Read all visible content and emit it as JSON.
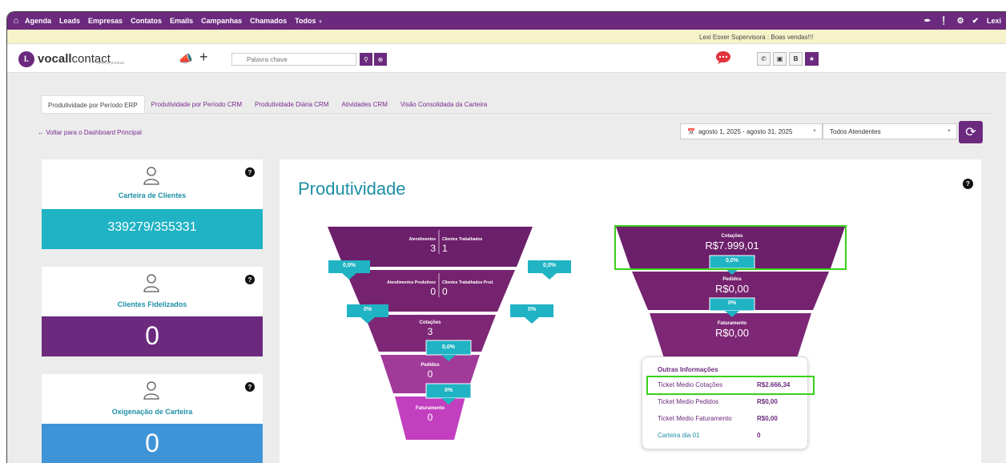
{
  "nav": {
    "items": [
      "Agenda",
      "Leads",
      "Empresas",
      "Contatos",
      "Emails",
      "Campanhas",
      "Chamados",
      "Todos"
    ],
    "user": "Lexi"
  },
  "infobar": {
    "message": "Lexi Eoxer Supervisora : Boas vendas!!!"
  },
  "toolbar": {
    "logo_bold": "vocall",
    "logo_light": "contact",
    "logo_sub": "único e pontual",
    "search_placeholder": "Palavra chave",
    "contact_btn_b": "B"
  },
  "tabs": [
    {
      "label": "Produtividade por Período ERP",
      "active": true
    },
    {
      "label": "Produtividade por Período CRM"
    },
    {
      "label": "Produtividade Diária CRM"
    },
    {
      "label": "Atividades CRM"
    },
    {
      "label": "Visão Consolidada da Carteira"
    }
  ],
  "back_link": "Voltar para o Dashboard Principal",
  "filters": {
    "date_range": "agosto 1, 2025 - agosto 31, 2025",
    "attendant": "Todos Atendentes"
  },
  "cards": [
    {
      "label": "Carteira de Clientes",
      "value": "339279/355331",
      "color": "#1fb3c4"
    },
    {
      "label": "Clientes Fidelizados",
      "value": "0",
      "color": "#6b2a7e"
    },
    {
      "label": "Oxigenação de Carteira",
      "value": "0",
      "color": "#3f94d8"
    }
  ],
  "panel": {
    "title": "Produtividade"
  },
  "funnel_left": {
    "levels": [
      {
        "left_label": "Atendimentos",
        "left_value": "3",
        "right_label": "Clientes Trabalhados",
        "right_value": "1"
      },
      {
        "left_label": "Atendimentos Produtivos",
        "left_value": "0",
        "right_label": "Clientes Trabalhados Prod.",
        "right_value": "0"
      },
      {
        "label": "Cotações",
        "value": "3"
      },
      {
        "label": "Pedidos",
        "value": "0"
      },
      {
        "label": "Faturamento",
        "value": "0"
      }
    ],
    "rates": [
      "0,0%",
      "0,0%",
      "0%",
      "0%",
      "0,0%",
      "0%"
    ]
  },
  "funnel_right": {
    "levels": [
      {
        "label": "Cotações",
        "value": "R$7.999,01"
      },
      {
        "label": "Pedidos",
        "value": "R$0,00"
      },
      {
        "label": "Faturamento",
        "value": "R$0,00"
      }
    ],
    "rates": [
      "0,0%",
      "0%"
    ]
  },
  "other_info": {
    "title": "Outras Informações",
    "rows": [
      {
        "label": "Ticket Medio Cotações",
        "value": "R$2.666,34"
      },
      {
        "label": "Ticket Medio Pedidos",
        "value": "R$0,00"
      },
      {
        "label": "Ticket Medio Faturamento",
        "value": "R$0,00"
      },
      {
        "label": "Carteira dia 01",
        "value": "0"
      }
    ]
  },
  "colors": {
    "brand": "#6b2a7e",
    "accent": "#1d8fa6",
    "highlight": "#39d11a",
    "teal_tag": "#1fb3c4"
  }
}
